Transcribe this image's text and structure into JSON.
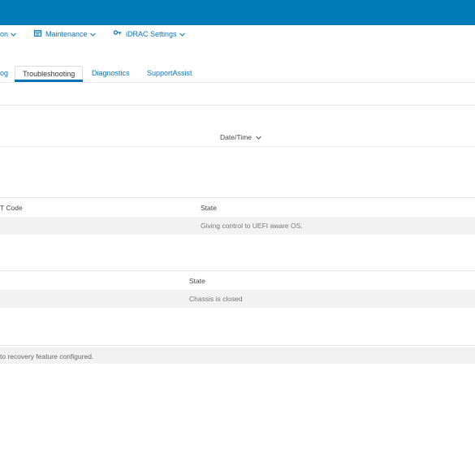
{
  "nav": {
    "item1_label": "on",
    "maintenance_label": "Maintenance",
    "idrac_label": "iDRAC Settings"
  },
  "tabs": [
    {
      "label": "og"
    },
    {
      "label": "Troubleshooting"
    },
    {
      "label": "Diagnostics"
    },
    {
      "label": "SupportAssist"
    }
  ],
  "video_section": {
    "datetime_header": "Date/Time"
  },
  "post_section": {
    "code_header": "T Code",
    "state_header": "State",
    "state_value": "Giving control to UEFI aware OS."
  },
  "intrusion_section": {
    "state_header": "State",
    "state_value": "Chassis is closed"
  },
  "recovery_section": {
    "message": "to recovery feature configured."
  },
  "colors": {
    "header_blue": "#007bb8",
    "link_blue": "#0b73b9"
  },
  "icons": {
    "maintenance": "maintenance-icon",
    "idrac_settings": "key-settings-icon",
    "chevron": "chevron-down-icon"
  }
}
